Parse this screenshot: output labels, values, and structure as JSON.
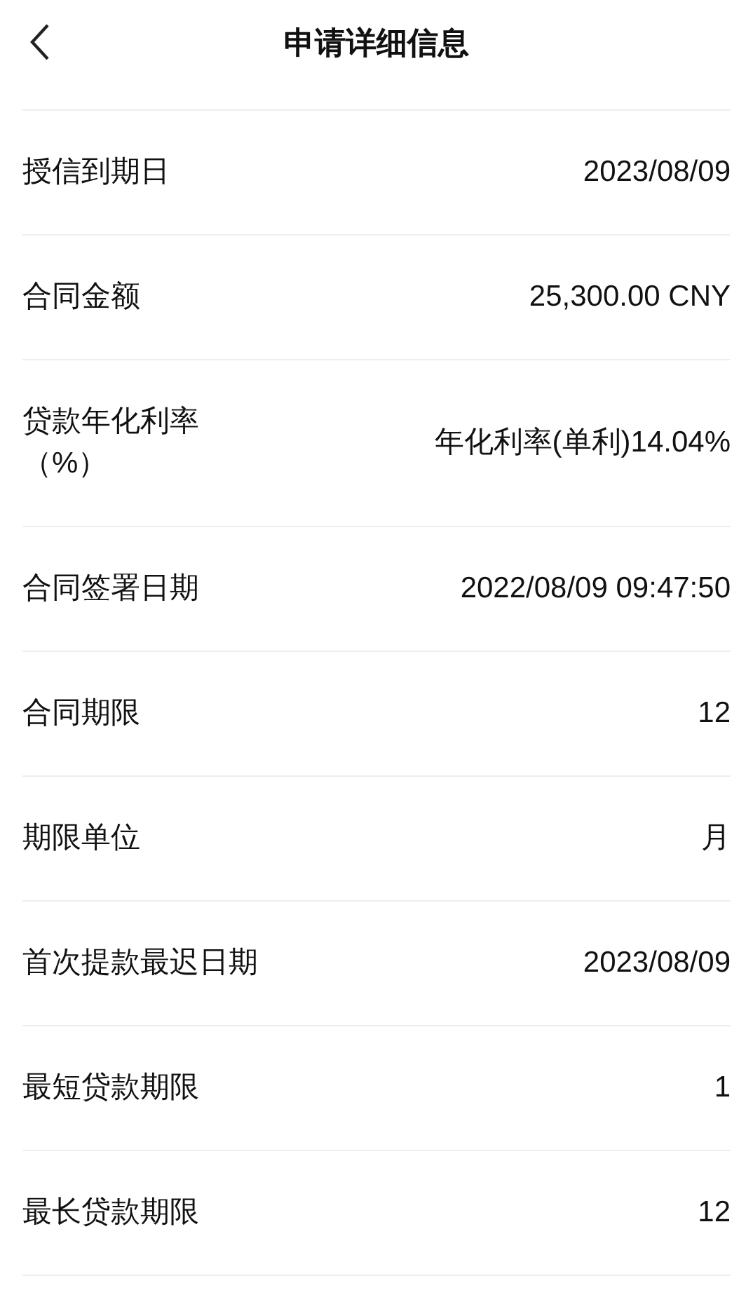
{
  "header": {
    "title": "申请详细信息"
  },
  "rows": [
    {
      "label": "授信到期日",
      "value": "2023/08/09"
    },
    {
      "label": "合同金额",
      "value": "25,300.00 CNY"
    },
    {
      "label": "贷款年化利率（%）",
      "value": "年化利率(单利)14.04%"
    },
    {
      "label": "合同签署日期",
      "value": "2022/08/09 09:47:50"
    },
    {
      "label": "合同期限",
      "value": "12"
    },
    {
      "label": "期限单位",
      "value": "月"
    },
    {
      "label": "首次提款最迟日期",
      "value": "2023/08/09"
    },
    {
      "label": "最短贷款期限",
      "value": "1"
    },
    {
      "label": "最长贷款期限",
      "value": "12"
    }
  ]
}
